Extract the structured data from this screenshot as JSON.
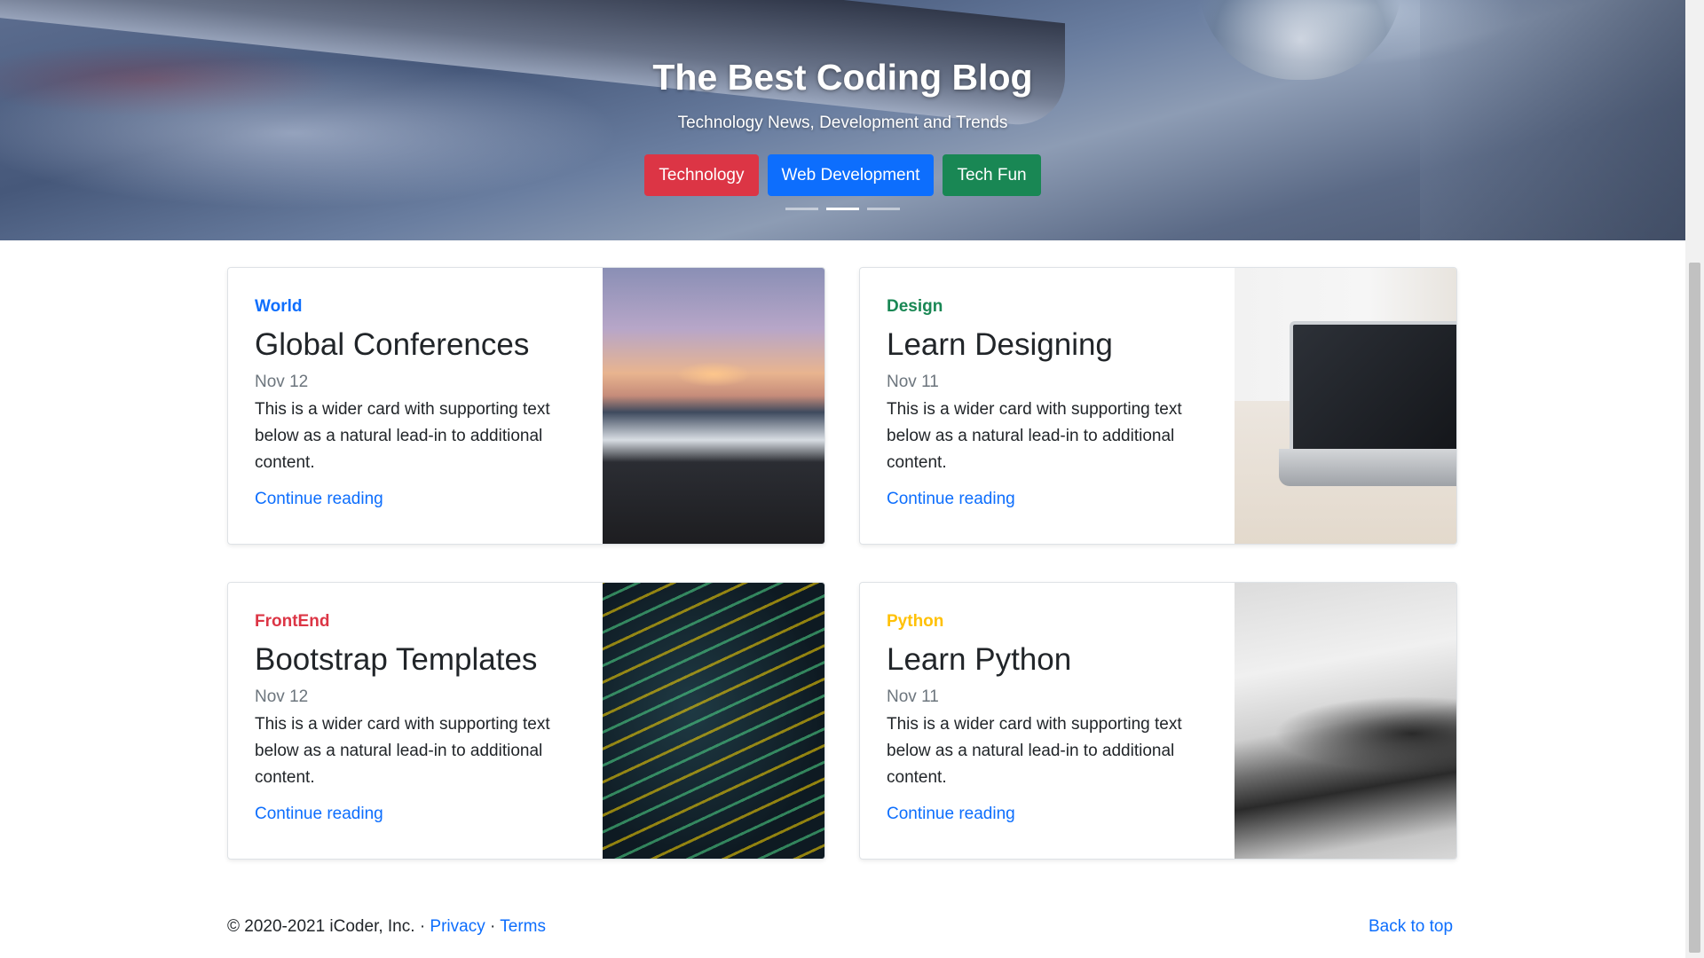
{
  "hero": {
    "title": "The Best Coding Blog",
    "subtitle": "Technology News, Development and Trends",
    "buttons": [
      {
        "label": "Technology",
        "color": "#dc3545"
      },
      {
        "label": "Web Development",
        "color": "#0d6efd"
      },
      {
        "label": "Tech Fun",
        "color": "#198754"
      }
    ],
    "indicators": {
      "count": 3,
      "active_index": 1
    }
  },
  "cards": [
    {
      "category": "World",
      "category_color": "#0d6efd",
      "title": "Global Conferences",
      "date": "Nov 12",
      "text": "This is a wider card with supporting text below as a natural lead-in to additional content.",
      "link": "Continue reading"
    },
    {
      "category": "Design",
      "category_color": "#198754",
      "title": "Learn Designing",
      "date": "Nov 11",
      "text": "This is a wider card with supporting text below as a natural lead-in to additional content.",
      "link": "Continue reading"
    },
    {
      "category": "FrontEnd",
      "category_color": "#dc3545",
      "title": "Bootstrap Templates",
      "date": "Nov 12",
      "text": "This is a wider card with supporting text below as a natural lead-in to additional content.",
      "link": "Continue reading"
    },
    {
      "category": "Python",
      "category_color": "#ffc107",
      "title": "Learn Python",
      "date": "Nov 11",
      "text": "This is a wider card with supporting text below as a natural lead-in to additional content.",
      "link": "Continue reading"
    }
  ],
  "footer": {
    "copyright": "© 2020-2021 iCoder, Inc.",
    "separator": "·",
    "privacy": "Privacy",
    "terms": "Terms",
    "back_to_top": "Back to top"
  }
}
